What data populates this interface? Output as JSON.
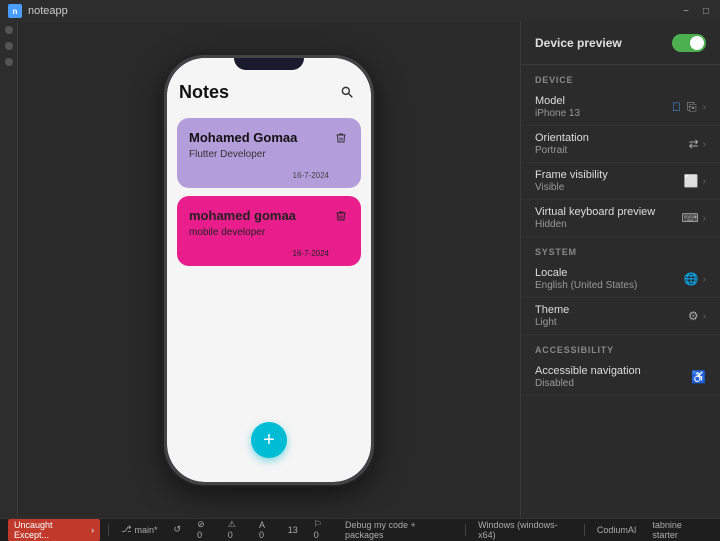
{
  "titleBar": {
    "appName": "noteapp",
    "minimizeLabel": "−",
    "maximizeLabel": "□"
  },
  "devicePreview": {
    "headerTitle": "Device preview",
    "toggleState": "on",
    "sections": {
      "device": {
        "label": "DEVICE",
        "items": [
          {
            "name": "Model",
            "value": "iPhone 13",
            "icons": [
              "apple",
              "phone",
              "chevron"
            ]
          },
          {
            "name": "Orientation",
            "value": "Portrait",
            "icon": "rotate"
          },
          {
            "name": "Frame visibility",
            "value": "Visible",
            "icon": "frame"
          },
          {
            "name": "Virtual keyboard preview",
            "value": "Hidden",
            "icon": "keyboard"
          }
        ]
      },
      "system": {
        "label": "SYSTEM",
        "items": [
          {
            "name": "Locale",
            "value": "English (United States)",
            "icon": "globe"
          },
          {
            "name": "Theme",
            "value": "Light",
            "icon": "gear"
          }
        ]
      },
      "accessibility": {
        "label": "ACCESSIBILITY",
        "items": [
          {
            "name": "Accessible navigation",
            "value": "Disabled"
          }
        ]
      }
    }
  },
  "app": {
    "title": "Notes",
    "searchLabel": "search",
    "fabLabel": "+",
    "notes": [
      {
        "id": 1,
        "name": "Mohamed Gomaa",
        "subtitle": "Flutter Developer",
        "date": "16-7-2024",
        "color": "purple"
      },
      {
        "id": 2,
        "name": "mohamed gomaa",
        "subtitle": "mobile developer",
        "date": "16-7-2024",
        "color": "pink"
      }
    ]
  },
  "taskbar": {
    "error": "Uncaught Except...",
    "errorArrow": "›",
    "gitBranch": "main*",
    "gitSync": "↺",
    "status1": "⊘ 0",
    "status2": "⚠ 0",
    "status3": "A 0",
    "status4": "13",
    "status5": "⚐ 0",
    "debugLabel": "Debug my code + packages",
    "platform": "Windows (windows-x64)",
    "ai1": "CodiumAI",
    "ai2": "tabnine starter"
  }
}
